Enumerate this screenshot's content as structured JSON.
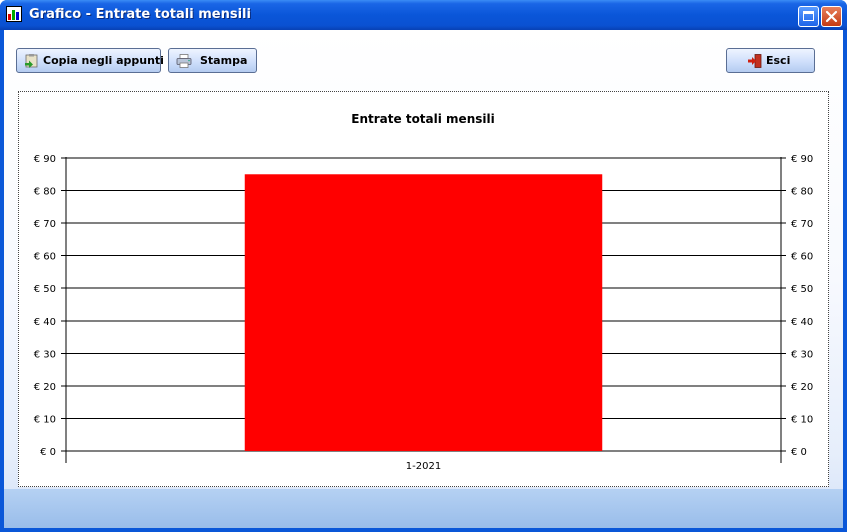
{
  "window": {
    "title": "Grafico - Entrate totali mensili"
  },
  "toolbar": {
    "copy_label": "Copia negli appunti",
    "print_label": "Stampa",
    "exit_label": "Esci"
  },
  "colors": {
    "bar": "#ff0000",
    "titlebar": "#0a56d9"
  },
  "icons": {
    "app": "chart-app-icon",
    "copy": "clipboard-icon",
    "print": "printer-icon",
    "exit": "exit-door-icon",
    "maximize": "maximize-icon",
    "close": "close-icon"
  },
  "chart_data": {
    "type": "bar",
    "title": "Entrate totali mensili",
    "categories": [
      "1-2021"
    ],
    "values": [
      85
    ],
    "ylim": [
      0,
      90
    ],
    "yticks": [
      0,
      10,
      20,
      30,
      40,
      50,
      60,
      70,
      80,
      90
    ],
    "tick_prefix": "€ ",
    "grid": true,
    "secondary_axis": "right"
  }
}
